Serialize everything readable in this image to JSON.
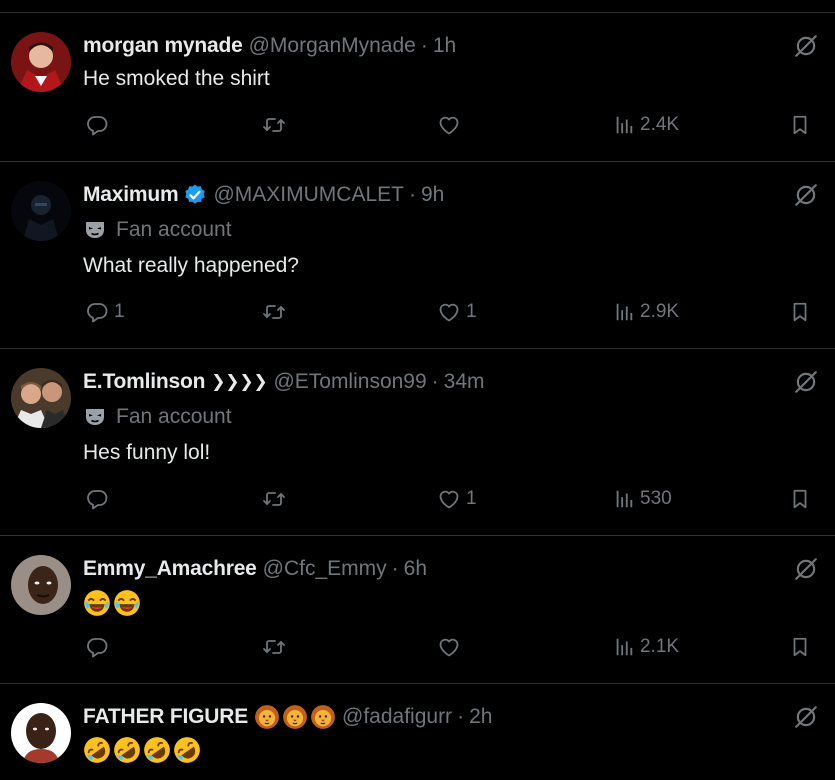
{
  "colors": {
    "background": "#000000",
    "text": "#e7e9ea",
    "muted": "#71767b",
    "divider": "#2f3336",
    "verified": "#1d9bf0"
  },
  "posts": [
    {
      "name": "morgan mynade",
      "handle": "@MorganMynade",
      "time": "1h",
      "text": "He smoked the shirt",
      "fan_label": "",
      "replies": "",
      "reposts": "",
      "likes": "",
      "views": "2.4K"
    },
    {
      "name": "Maximum",
      "verified": true,
      "handle": "@MAXIMUMCALET",
      "time": "9h",
      "fan_label": "Fan account",
      "text": "What really happened?",
      "replies": "1",
      "reposts": "",
      "likes": "1",
      "views": "2.9K"
    },
    {
      "name": "E.Tomlinson",
      "name_badge": "❯❯❯❯",
      "handle": "@ETomlinson99",
      "time": "34m",
      "fan_label": "Fan account",
      "text": "Hes funny lol!",
      "replies": "",
      "reposts": "",
      "likes": "1",
      "views": "530"
    },
    {
      "name": "Emmy_Amachree",
      "handle": "@Cfc_Emmy",
      "time": "6h",
      "text": "",
      "emojis": [
        "face-with-tears-of-joy",
        "face-with-tears-of-joy"
      ],
      "replies": "",
      "reposts": "",
      "likes": "",
      "views": "2.1K"
    },
    {
      "name": "FATHER FIGURE",
      "name_emojis": [
        "lion-face",
        "lion-face",
        "lion-face"
      ],
      "handle": "@fadafigurr",
      "time": "2h",
      "text": "",
      "emojis": [
        "rolling-on-floor-laughing",
        "rolling-on-floor-laughing",
        "rolling-on-floor-laughing",
        "rolling-on-floor-laughing"
      ]
    }
  ],
  "icons": {
    "reply": "reply-icon",
    "repost": "repost-icon",
    "like": "like-icon",
    "views": "views-icon",
    "bookmark": "bookmark-icon",
    "grok": "grok-icon",
    "fan": "fan-mask-icon"
  }
}
